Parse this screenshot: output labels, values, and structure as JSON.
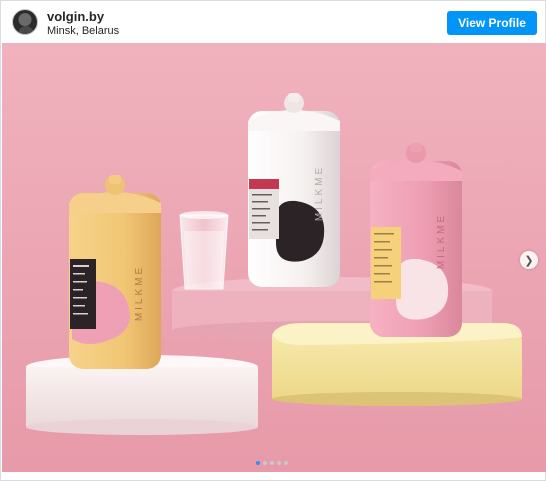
{
  "header": {
    "username": "volgin.by",
    "location": "Minsk, Belarus",
    "view_profile_label": "View Profile"
  },
  "post": {
    "brand_text": "MILKME",
    "carousel": {
      "current": 1,
      "total": 5
    },
    "colors": {
      "background": "#eca9b6",
      "bottle_yellow": "#f3c97a",
      "bottle_white": "#f6f1ef",
      "bottle_pink": "#ef9fb3",
      "accent_blue": "#0095f6"
    }
  },
  "icons": {
    "next": "chevron-right-icon"
  }
}
